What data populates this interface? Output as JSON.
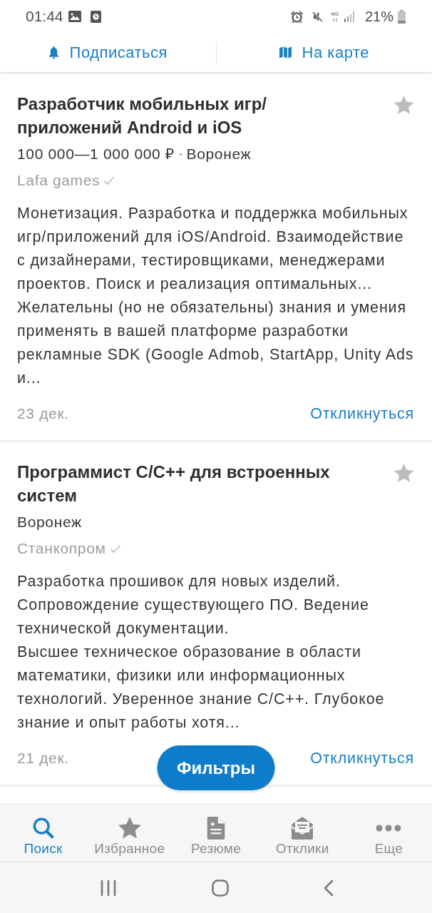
{
  "status_bar": {
    "time": "01:44",
    "network": "4G",
    "battery": "21%"
  },
  "actions": [
    {
      "label": "Подписаться"
    },
    {
      "label": "На карте"
    }
  ],
  "vacancies": [
    {
      "title": "Разработчик мобильных игр/приложений Android и iOS",
      "favorite": false,
      "salary": "100 000—1 000 000 ₽",
      "city": "Воронеж",
      "company": "Lafa games",
      "verified": true,
      "description": [
        "Монетизация. Разработка и поддержка мобильных игр/приложений для iOS/Android. Взаимодействие с дизайнерами, тестировщиками, менеджерами проектов. Поиск и реализация оптимальных...",
        "Желательны (но не обязательны) знания и умения применять в вашей платформе разработки рекламные SDK (Google Admob, StartApp, Unity Ads и..."
      ],
      "date": "23 дек.",
      "action": "Откликнуться"
    },
    {
      "title": "Программист C/C++ для встроенных систем",
      "favorite": false,
      "city": "Воронеж",
      "company": "Станкопром",
      "verified": true,
      "description": [
        "Разработка прошивок для новых изделий. Сопровождение существующего ПО. Ведение технической документации.",
        "Высшее техническое образование в области математики, физики или информационных технологий. Уверенное знание C/C++. Глубокое знание и опыт работы хотя..."
      ],
      "date": "21 дек.",
      "action": "Откликнуться"
    }
  ],
  "filter_button": {
    "label": "Фильтры"
  },
  "bottom_nav": [
    {
      "label": "Поиск",
      "selected": true
    },
    {
      "label": "Избранное",
      "selected": false
    },
    {
      "label": "Резюме",
      "selected": false
    },
    {
      "label": "Отклики",
      "selected": false
    },
    {
      "label": "Еще",
      "selected": false
    }
  ]
}
